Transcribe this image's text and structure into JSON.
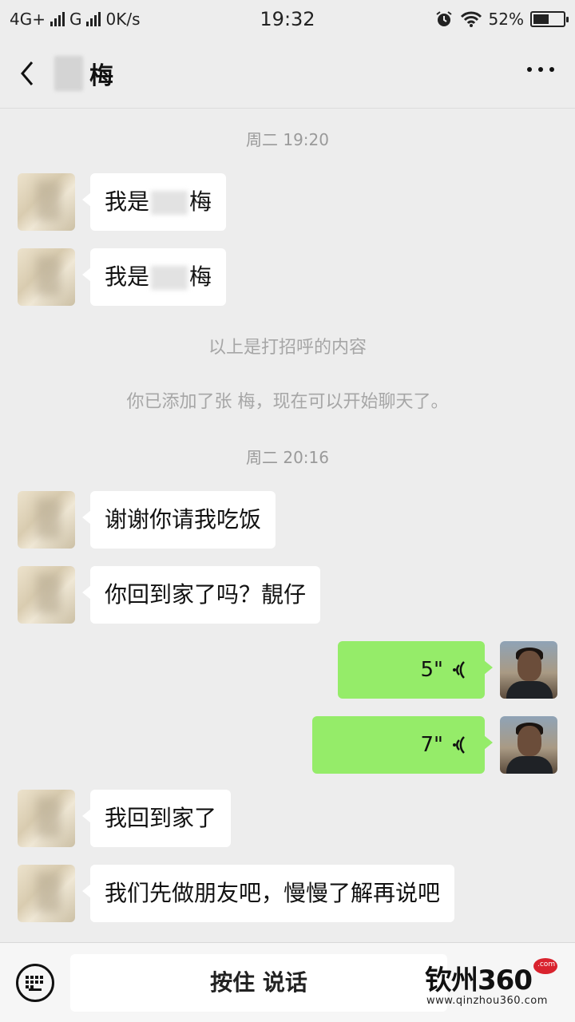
{
  "status_bar": {
    "network_1": "4G+",
    "network_2": "G",
    "speed": "0K/s",
    "time": "19:32",
    "battery": "52%",
    "battery_level": 0.52
  },
  "nav": {
    "title": "梅"
  },
  "chat": {
    "timestamp_1": "周二 19:20",
    "msg_1": {
      "pre": "我是",
      "post": "梅"
    },
    "msg_2": {
      "pre": "我是",
      "post": "梅"
    },
    "sys_1": "以上是打招呼的内容",
    "sys_2": "你已添加了张  梅，现在可以开始聊天了。",
    "timestamp_2": "周二 20:16",
    "msg_3": "谢谢你请我吃饭",
    "msg_4": "你回到家了吗？靚仔",
    "voice_1": "5\"",
    "voice_2": "7\"",
    "msg_5": "我回到家了",
    "msg_6": "我们先做朋友吧，慢慢了解再说吧"
  },
  "input_bar": {
    "hold_to_talk": "按住 说话"
  },
  "watermark": {
    "logo": "钦州360",
    "badge": ".com",
    "url": "www.qinzhou360.com"
  },
  "colors": {
    "background": "#ededed",
    "outgoing_bubble": "#95ec69",
    "incoming_bubble": "#ffffff",
    "system_text": "#a6a6a6"
  }
}
